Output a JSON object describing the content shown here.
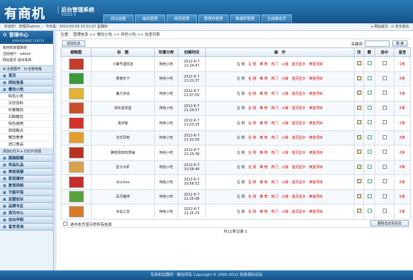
{
  "header": {
    "logo": "有商机",
    "system": "后台管理系统",
    "version": "V2012.3",
    "nav": [
      "网站设置",
      "级权管理",
      "频道管理",
      "管理员管理",
      "数据库管理",
      "生成静态页"
    ]
  },
  "infobar": {
    "welcome": "欢迎您！ 管理员admin ， 今天是：2013-03-05 15:51:07 星期四",
    "links": [
      "网站首页",
      "安全退出"
    ]
  },
  "sidebar": {
    "title": "管理中心",
    "subtitle": "MANAGEMENT CENTER",
    "info": [
      "有商机管理系统",
      "当前用户：admin",
      "网站首页  退出系统"
    ],
    "expand": "全部展开",
    "collapse": "全部收缩",
    "groups": [
      {
        "label": "首页",
        "items": []
      },
      {
        "label": "网站信息",
        "items": []
      },
      {
        "label": "餐饮小吃",
        "items": [
          "特色小吃",
          "冷饮饮料",
          "中餐餐饮",
          "日韩餐饮",
          "特色烧烤",
          "烘焙糕点",
          "餐饮美食",
          "进口食品"
        ]
      },
      {
        "label": "添加幻灯片 ▸ 幻灯片管理",
        "items": []
      },
      {
        "label": "服装鞋帽",
        "items": []
      },
      {
        "label": "饰品礼品",
        "items": []
      },
      {
        "label": "美容保健",
        "items": []
      },
      {
        "label": "家居建材",
        "items": []
      },
      {
        "label": "教育网络",
        "items": []
      },
      {
        "label": "节能环保",
        "items": []
      },
      {
        "label": "加盟创业",
        "items": []
      },
      {
        "label": "品牌专区",
        "items": []
      },
      {
        "label": "资讯中心",
        "items": []
      },
      {
        "label": "创业学院",
        "items": []
      },
      {
        "label": "留言咨询",
        "items": []
      }
    ]
  },
  "main": {
    "breadcrumb": "位置： 管理信息 >> 餐饮小吃 >> 特色小吃 >> 信息列表",
    "add_button": "增加信息",
    "keyword_label": "关键词：",
    "search_button": "搜 索",
    "columns": [
      "缩略图",
      "标　题",
      "所属分类",
      "创建时间",
      "操　作",
      "改",
      "删",
      "选中",
      "留言"
    ],
    "ops": [
      "左 侧",
      "右 侧",
      "推 荐",
      "热门",
      "火爆",
      "首页显示",
      "黄金项目"
    ],
    "rows": [
      {
        "title": "小螺号酒饮店",
        "cat": "特色小吃",
        "date": "2012-6-7",
        "time": "21:24:47",
        "msg": "0条",
        "color": "#c83a2a"
      },
      {
        "title": "香巷天下",
        "cat": "特色小吃",
        "date": "2012-6-7",
        "time": "21:22:37",
        "msg": "0条",
        "color": "#3a9a3a"
      },
      {
        "title": "魔力多纹",
        "cat": "特色小吃",
        "date": "2012-6-7",
        "time": "21:07:00",
        "msg": "0条",
        "color": "#e2b233"
      },
      {
        "title": "快乐星欢堡",
        "cat": "特色小吃",
        "date": "2012-6-7",
        "time": "21:24:57",
        "msg": "0条",
        "color": "#c94f2b"
      },
      {
        "title": "黑米客",
        "cat": "特色小吃",
        "date": "2012-6-7",
        "time": "21:03:25",
        "msg": "0条",
        "color": "#d6302b"
      },
      {
        "title": "法式风吧",
        "cat": "特色小吃",
        "date": "2012-6-7",
        "time": "21:02:00",
        "msg": "0条",
        "color": "#e39d2a"
      },
      {
        "title": "腾桂思田鸡煲铺",
        "cat": "特色小吃",
        "date": "2012-6-7",
        "time": "21:25:38",
        "msg": "0条",
        "color": "#b83323"
      },
      {
        "title": "臣子大虾",
        "cat": "特色小吃",
        "date": "2012-6-7",
        "time": "20:58:48",
        "msg": "0条",
        "color": "#d8a24a"
      },
      {
        "title": "冰火kiss",
        "cat": "特色小吃",
        "date": "2012-6-7",
        "time": "20:58:52",
        "msg": "0条",
        "color": "#c92a2a"
      },
      {
        "title": "百灵猪排",
        "cat": "特色小吃",
        "date": "2012-6-7",
        "time": "21:25:08",
        "msg": "0条",
        "color": "#5aa03c"
      },
      {
        "title": "冰岛之恋",
        "cat": "特色小吃",
        "date": "2012-6-7",
        "time": "21:25:23",
        "msg": "0条",
        "color": "#d87a2a"
      }
    ],
    "select_all": "选中本页显示的所有信息",
    "delete_button": "删除选定的信息",
    "total": "共11条记录  1"
  },
  "footer": "有商机加盟网 · 都柱所有 Copyright © 2005-2012 免费源码论坛"
}
